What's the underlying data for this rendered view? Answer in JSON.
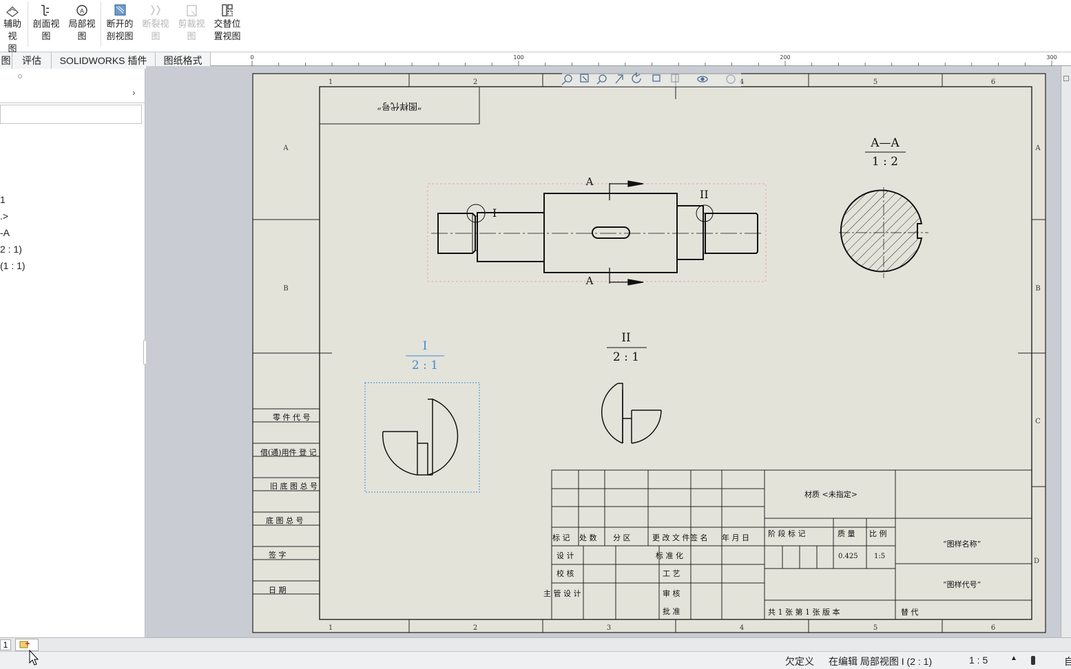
{
  "ribbon": {
    "buttons": [
      {
        "label_line1": "辅助视",
        "label_line2": "图",
        "icon": "auxiliary-view-icon",
        "enabled": true
      },
      {
        "label_line1": "剖面视",
        "label_line2": "图",
        "icon": "section-view-icon",
        "enabled": true
      },
      {
        "label_line1": "局部视",
        "label_line2": "图",
        "icon": "detail-view-icon",
        "enabled": true
      },
      {
        "label_line1": "断开的",
        "label_line2": "剖视图",
        "icon": "broken-out-section-icon",
        "enabled": true
      },
      {
        "label_line1": "断裂视",
        "label_line2": "图",
        "icon": "break-view-icon",
        "enabled": false
      },
      {
        "label_line1": "剪裁视",
        "label_line2": "图",
        "icon": "crop-view-icon",
        "enabled": false
      },
      {
        "label_line1": "交替位",
        "label_line2": "置视图",
        "icon": "alternate-position-view-icon",
        "enabled": true
      }
    ]
  },
  "tabs": [
    {
      "label": "图"
    },
    {
      "label": "评估"
    },
    {
      "label": "SOLIDWORKS 插件"
    },
    {
      "label": "图纸格式"
    }
  ],
  "tree": {
    "items": [
      "1",
      ".>",
      "-A",
      "2 : 1)",
      "(1 : 1)"
    ]
  },
  "ruler": {
    "labels": [
      "0",
      "100",
      "200",
      "300"
    ]
  },
  "drawing": {
    "zone_cols": [
      "1",
      "2",
      "3",
      "4",
      "5",
      "6"
    ],
    "zone_rows": [
      "A",
      "B",
      "C",
      "D"
    ],
    "drawing_no_box": "“图样代号”",
    "section_label": "A",
    "section_view_title": "A—A",
    "section_view_scale": "1 : 2",
    "detail_label_1": "I",
    "detail_label_2": "II",
    "detail1_title": "I",
    "detail1_scale": "2 : 1",
    "detail2_title": "II",
    "detail2_scale": "2 : 1",
    "left_block": [
      "零 件 代 号",
      "借(通)用件 登 记",
      "旧 底 图 总 号",
      "底 图 总 号",
      "签 字",
      "日 期"
    ],
    "title_block": {
      "rev_headers": [
        "标 记",
        "处 数",
        "分 区",
        "更 改 文 件",
        "签 名",
        "年 月 日"
      ],
      "signers": [
        "设 计",
        "校 核",
        "主 管 设 计",
        "标 准 化",
        "工 艺",
        "审 核",
        "批 准"
      ],
      "material": "材质 <未指定>",
      "stage_header": "阶 段 标 记",
      "mass_header": "质 量",
      "scale_header": "比 例",
      "mass_value": "0.425",
      "scale_value": "1:5",
      "drawing_name": "“图样名称”",
      "drawing_code": "“图样代号”",
      "sheet_info": "共 1 张 第 1 张 版 本",
      "replace": "替 代"
    }
  },
  "status": {
    "definition": "欠定义",
    "editing": "在编辑 局部视图 I (2 : 1)",
    "scale": "1 : 5",
    "extra": "自"
  },
  "sheet_tab": "1",
  "colors": {
    "sheet_bg": "#e4e3da",
    "line": "#111111",
    "selected_detail": "#3a8fd8",
    "preselect_box": "#e8a0b4"
  }
}
